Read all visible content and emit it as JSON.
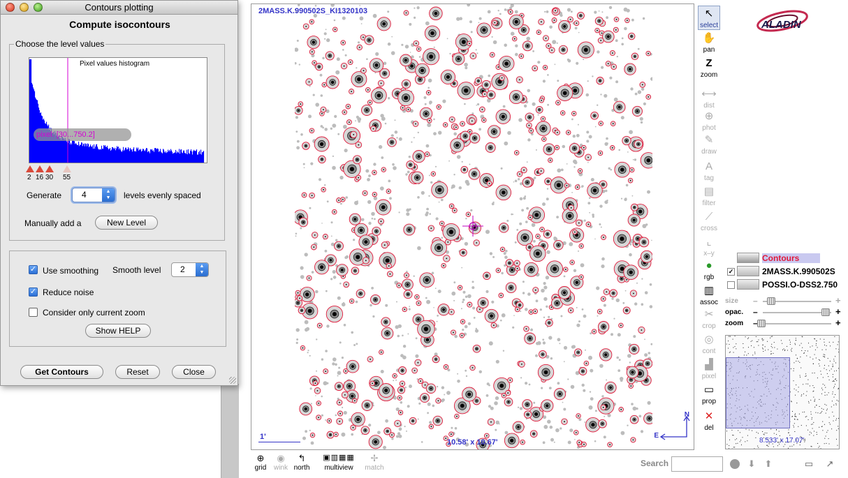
{
  "dialog": {
    "title": "Contours plotting",
    "heading": "Compute isocontours",
    "level_group_label": "Choose the level values",
    "histogram": {
      "title": "Pixel values histogram",
      "pixel_tooltip": "pixel: [30...750.2]",
      "level_markers": [
        "2",
        "16",
        "30",
        "55"
      ]
    },
    "generate_label": "Generate",
    "levels_count": "4",
    "evenly_label": "levels evenly spaced",
    "manual_label": "Manually add a",
    "new_level_button": "New Level",
    "use_smoothing_label": "Use smoothing",
    "use_smoothing_checked": true,
    "smooth_level_label": "Smooth level",
    "smooth_level_value": "2",
    "reduce_noise_label": "Reduce noise",
    "reduce_noise_checked": true,
    "current_zoom_label": "Consider only current zoom",
    "current_zoom_checked": false,
    "show_help_button": "Show HELP",
    "get_contours_button": "Get Contours",
    "reset_button": "Reset",
    "close_button": "Close"
  },
  "view": {
    "image_title": "2MASS.K.990502S_KI1320103",
    "scale_label": "1'",
    "fov_label": "10.58' x 10.67'",
    "north_label": "N",
    "east_label": "E"
  },
  "right_toolbar": [
    {
      "label": "select",
      "icon": "select-arrow-icon",
      "glyph": "↖",
      "enabled": true,
      "selected": true
    },
    {
      "label": "pan",
      "icon": "hand-icon",
      "glyph": "✋",
      "enabled": true
    },
    {
      "label": "zoom",
      "icon": "zoom-icon",
      "glyph": "Z",
      "enabled": true
    },
    {
      "label": "dist",
      "icon": "distance-icon",
      "glyph": "⟷",
      "enabled": false
    },
    {
      "label": "phot",
      "icon": "photometry-icon",
      "glyph": "⊕",
      "enabled": false
    },
    {
      "label": "draw",
      "icon": "pencil-icon",
      "glyph": "✎",
      "enabled": false
    },
    {
      "label": "tag",
      "icon": "tag-icon",
      "glyph": "A",
      "enabled": false
    },
    {
      "label": "filter",
      "icon": "filter-icon",
      "glyph": "▤",
      "enabled": false
    },
    {
      "label": "cross",
      "icon": "cross-icon",
      "glyph": "⟋",
      "enabled": false
    },
    {
      "label": "x–y",
      "icon": "xy-plot-icon",
      "glyph": "⌞",
      "enabled": false
    },
    {
      "label": "rgb",
      "icon": "rgb-icon",
      "glyph": "●",
      "enabled": true
    },
    {
      "label": "assoc",
      "icon": "filmstrip-icon",
      "glyph": "▥",
      "enabled": true
    },
    {
      "label": "crop",
      "icon": "scissors-icon",
      "glyph": "✂",
      "enabled": false
    },
    {
      "label": "cont",
      "icon": "contour-icon",
      "glyph": "◎",
      "enabled": false
    },
    {
      "label": "pixel",
      "icon": "pixel-icon",
      "glyph": "▟",
      "enabled": false
    },
    {
      "label": "prop",
      "icon": "properties-icon",
      "glyph": "▭",
      "enabled": true
    },
    {
      "label": "del",
      "icon": "delete-icon",
      "glyph": "✕",
      "enabled": true
    }
  ],
  "layers": [
    {
      "name": "Contours",
      "checked": null
    },
    {
      "name": "2MASS.K.990502S",
      "checked": true
    },
    {
      "name": "POSSI.O-DSS2.750",
      "checked": false
    }
  ],
  "sliders": [
    {
      "label": "size",
      "value_fraction": 0.05,
      "enabled": false
    },
    {
      "label": "opac.",
      "value_fraction": 0.95,
      "enabled": true
    },
    {
      "label": "zoom",
      "value_fraction": 0.05,
      "enabled": true
    }
  ],
  "overview": {
    "label": "8.533' x 17.07'"
  },
  "bottom_toolbar": [
    {
      "label": "grid",
      "icon": "grid-globe-icon",
      "glyph": "⊕",
      "enabled": true
    },
    {
      "label": "wink",
      "icon": "eye-icon",
      "glyph": "◉",
      "enabled": false
    },
    {
      "label": "north",
      "icon": "north-arrow-icon",
      "glyph": "↰",
      "enabled": true
    },
    {
      "label": "multiview",
      "icon": "multiview-icon",
      "glyph": "▣▥▦",
      "enabled": true
    },
    {
      "label": "match",
      "icon": "match-icon",
      "glyph": "✢",
      "enabled": false
    }
  ],
  "search": {
    "label": "Search",
    "value": ""
  },
  "colors": {
    "contour": "#e0193a",
    "accent_blue": "#3434c8",
    "hist_bar": "#0000ff",
    "hist_marker": "#d400d4"
  }
}
